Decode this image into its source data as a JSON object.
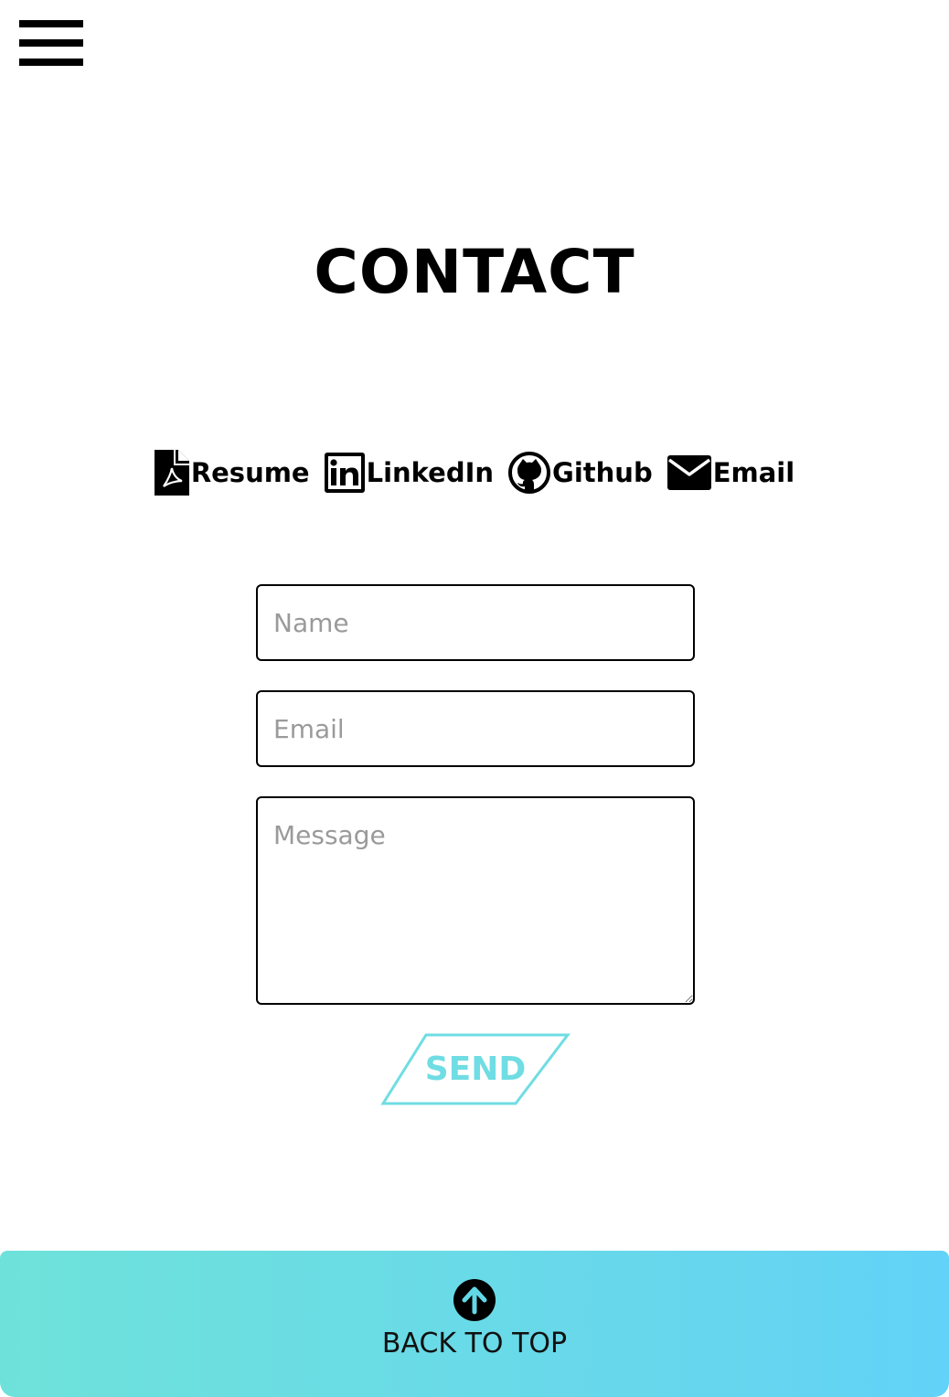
{
  "nav": {
    "menu_icon": "hamburger-menu-icon"
  },
  "header": {
    "title": "CONTACT"
  },
  "links": {
    "resume": {
      "label": "Resume",
      "icon": "pdf-file-icon"
    },
    "linkedin": {
      "label": "LinkedIn",
      "icon": "linkedin-icon"
    },
    "github": {
      "label": "Github",
      "icon": "github-icon"
    },
    "email": {
      "label": "Email",
      "icon": "envelope-icon"
    }
  },
  "form": {
    "name_placeholder": "Name",
    "email_placeholder": "Email",
    "message_placeholder": "Message",
    "send_label": "SEND"
  },
  "footer": {
    "back_to_top_label": "BACK TO TOP",
    "icon": "arrow-up-circle-icon"
  },
  "colors": {
    "accent": "#6fdde3",
    "footer_gradient_start": "#6ee2da",
    "footer_gradient_end": "#62d2f8"
  }
}
